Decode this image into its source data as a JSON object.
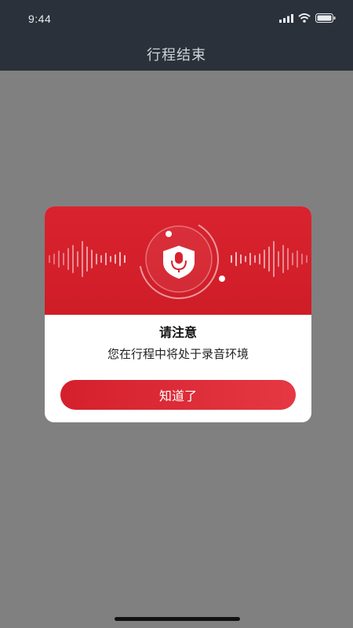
{
  "status_bar": {
    "time": "9:44",
    "icons": [
      "signal-icon",
      "wifi-icon",
      "battery-icon"
    ]
  },
  "header": {
    "title": "行程结束"
  },
  "dialog": {
    "icon": "microphone-shield-icon",
    "title": "请注意",
    "message": "您在行程中将处于录音环境",
    "confirm_label": "知道了"
  },
  "colors": {
    "accent": "#d9232f",
    "header_bg": "#2b313b",
    "overlay": "#808080"
  }
}
